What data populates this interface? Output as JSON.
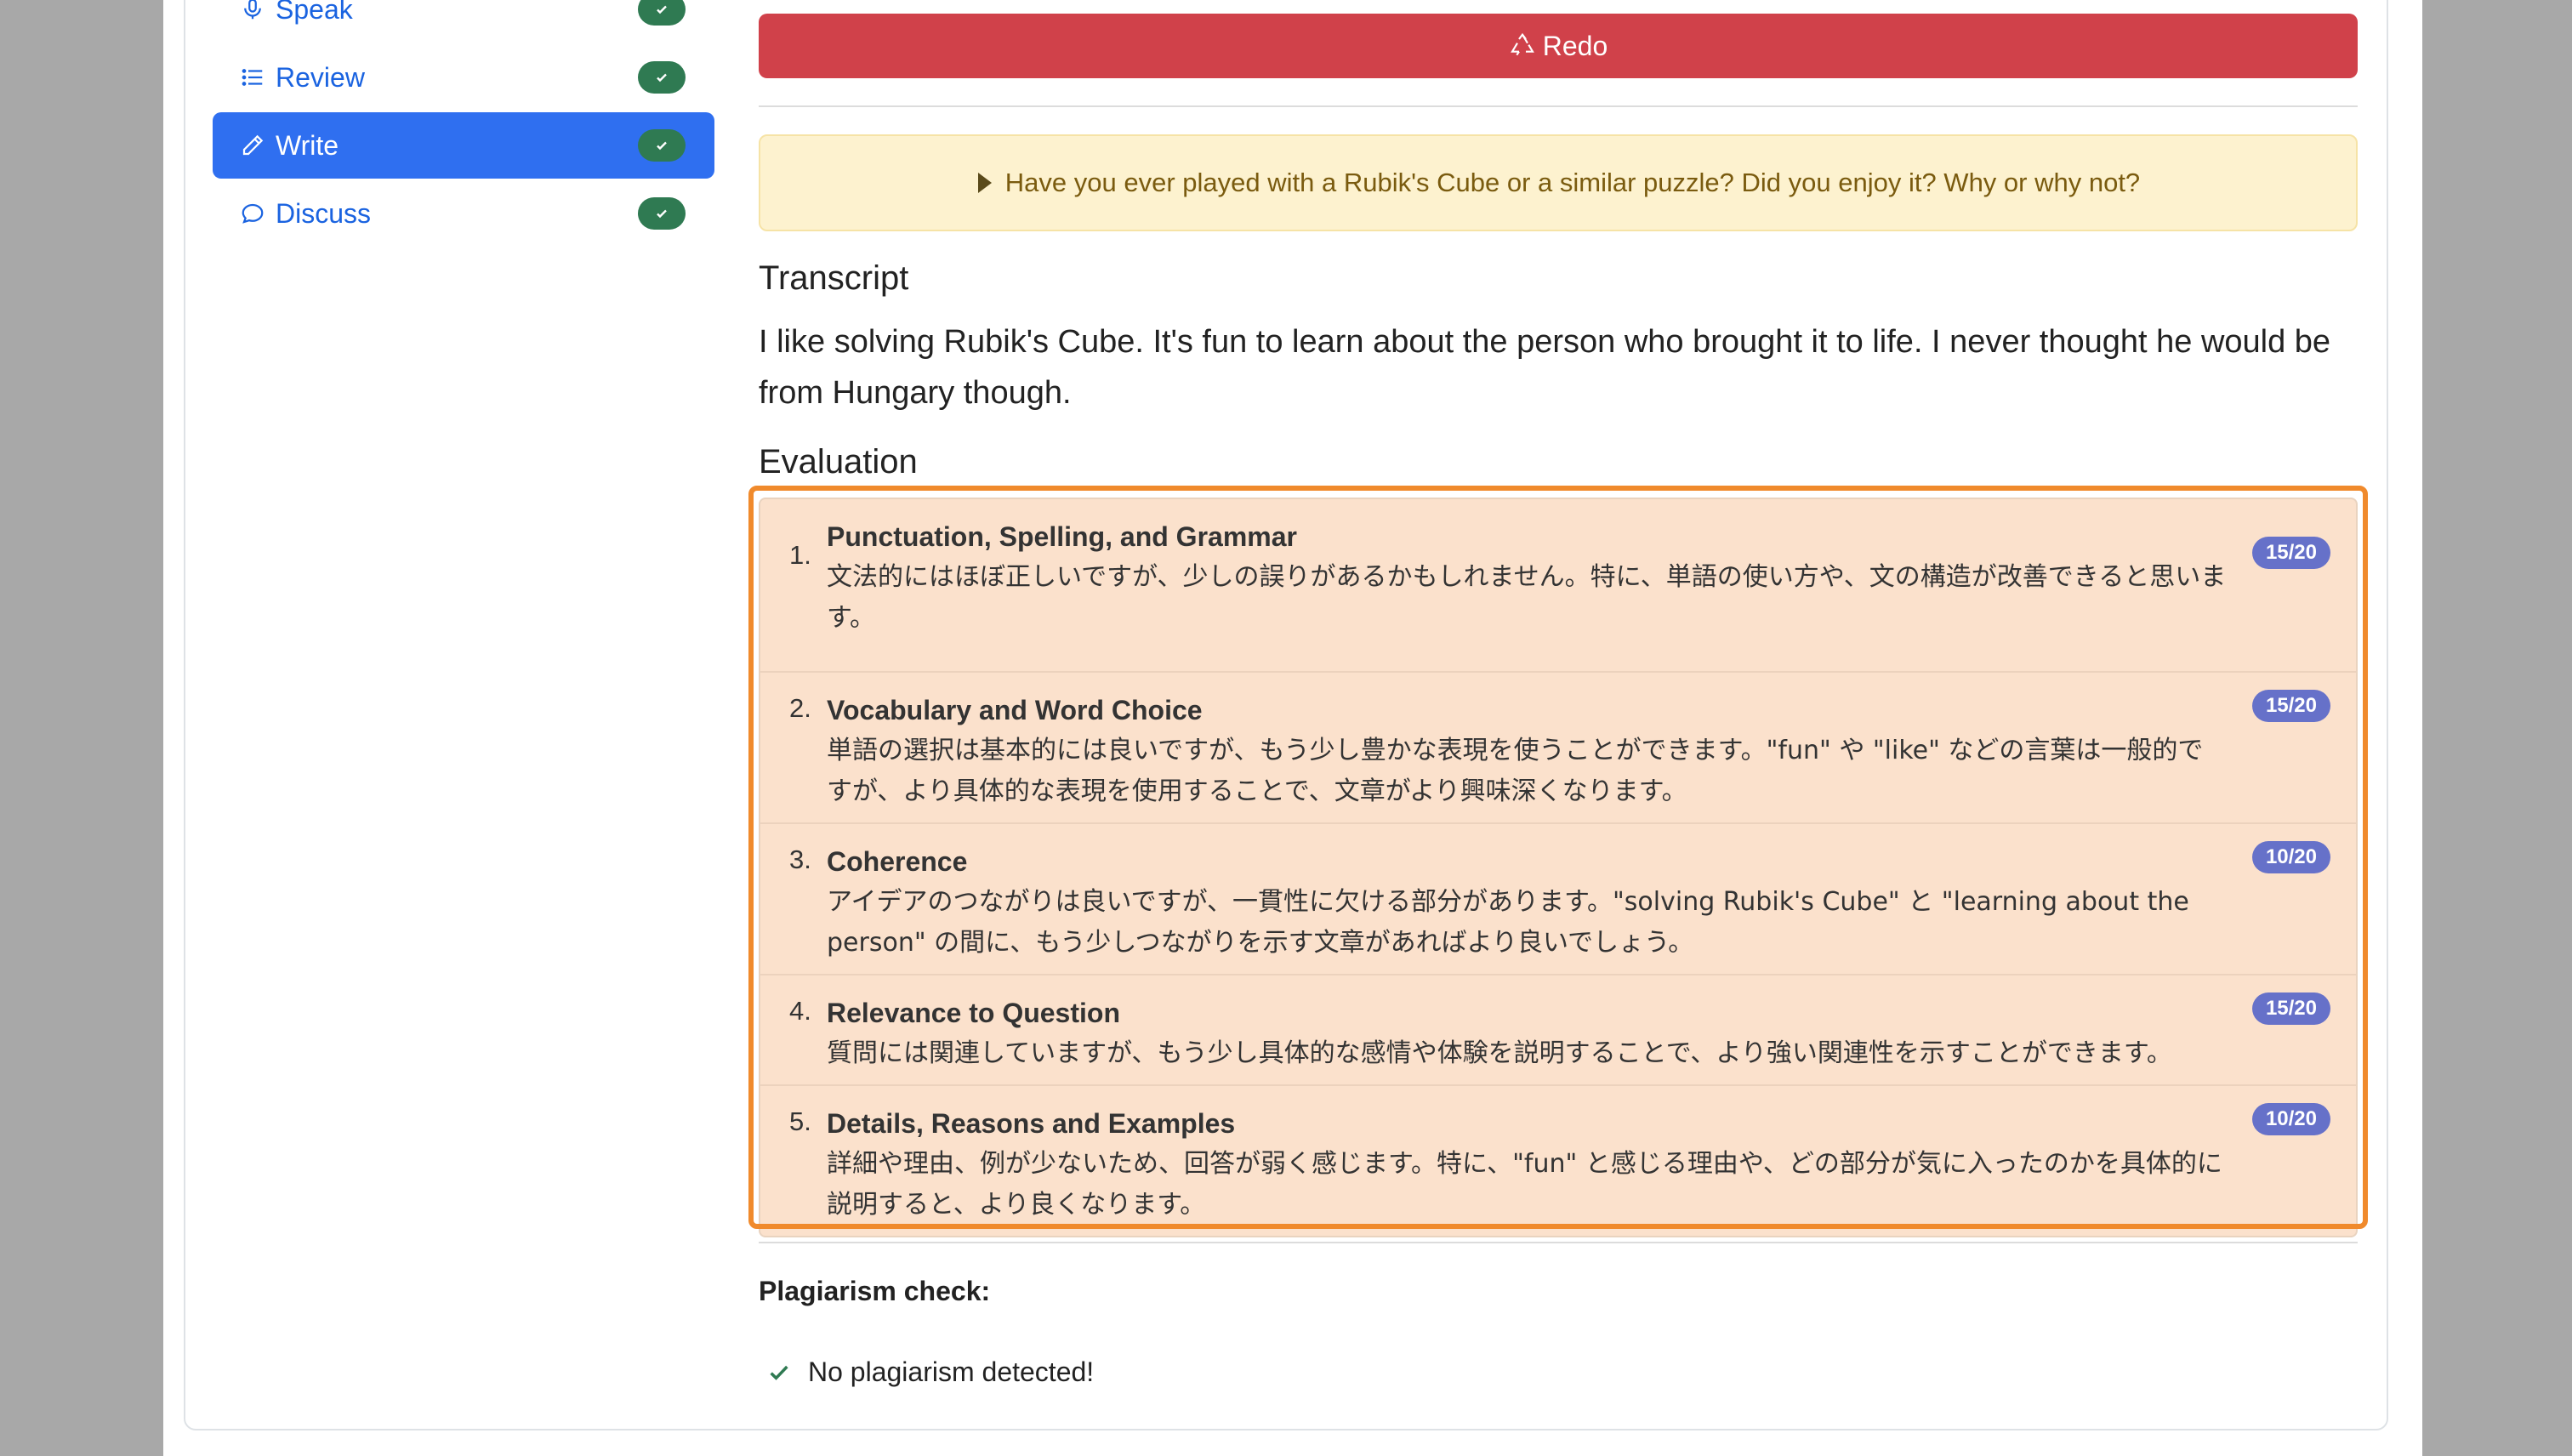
{
  "sidebar": {
    "items": [
      {
        "label": "Speak",
        "icon": "microphone-icon",
        "active": false,
        "completed": true
      },
      {
        "label": "Review",
        "icon": "list-icon",
        "active": false,
        "completed": true
      },
      {
        "label": "Write",
        "icon": "pencil-icon",
        "active": true,
        "completed": true
      },
      {
        "label": "Discuss",
        "icon": "chat-bubble-icon",
        "active": false,
        "completed": true
      }
    ]
  },
  "main": {
    "redo_label": "Redo",
    "question": "Have you ever played with a Rubik's Cube or a similar puzzle? Did you enjoy it? Why or why not?",
    "transcript_heading": "Transcript",
    "transcript_text": "I like solving Rubik's Cube. It's fun to learn about the person who brought it to life. I never thought he would be from Hungary though.",
    "evaluation_heading": "Evaluation",
    "evaluation": [
      {
        "num": "1.",
        "title": "Punctuation, Spelling, and Grammar",
        "score": "15/20",
        "desc": "文法的にはほぼ正しいですが、少しの誤りがあるかもしれません。特に、単語の使い方や、文の構造が改善できると思います。"
      },
      {
        "num": "2.",
        "title": "Vocabulary and Word Choice",
        "score": "15/20",
        "desc": "単語の選択は基本的には良いですが、もう少し豊かな表現を使うことができます。\"fun\" や \"like\" などの言葉は一般的ですが、より具体的な表現を使用することで、文章がより興味深くなります。"
      },
      {
        "num": "3.",
        "title": "Coherence",
        "score": "10/20",
        "desc": "アイデアのつながりは良いですが、一貫性に欠ける部分があります。\"solving Rubik's Cube\" と \"learning about the person\" の間に、もう少しつながりを示す文章があればより良いでしょう。"
      },
      {
        "num": "4.",
        "title": "Relevance to Question",
        "score": "15/20",
        "desc": "質問には関連していますが、もう少し具体的な感情や体験を説明することで、より強い関連性を示すことができます。"
      },
      {
        "num": "5.",
        "title": "Details, Reasons and Examples",
        "score": "10/20",
        "desc": "詳細や理由、例が少ないため、回答が弱く感じます。特に、\"fun\" と感じる理由や、どの部分が気に入ったのかを具体的に説明すると、より良くなります。"
      }
    ],
    "plagiarism_label": "Plagiarism check:",
    "plagiarism_result": "No plagiarism detected!"
  },
  "colors": {
    "accent": "#2f6ff0",
    "danger": "#d0414a",
    "success": "#2f7a52",
    "badge": "#6671c9",
    "highlight": "#f08a2c"
  }
}
